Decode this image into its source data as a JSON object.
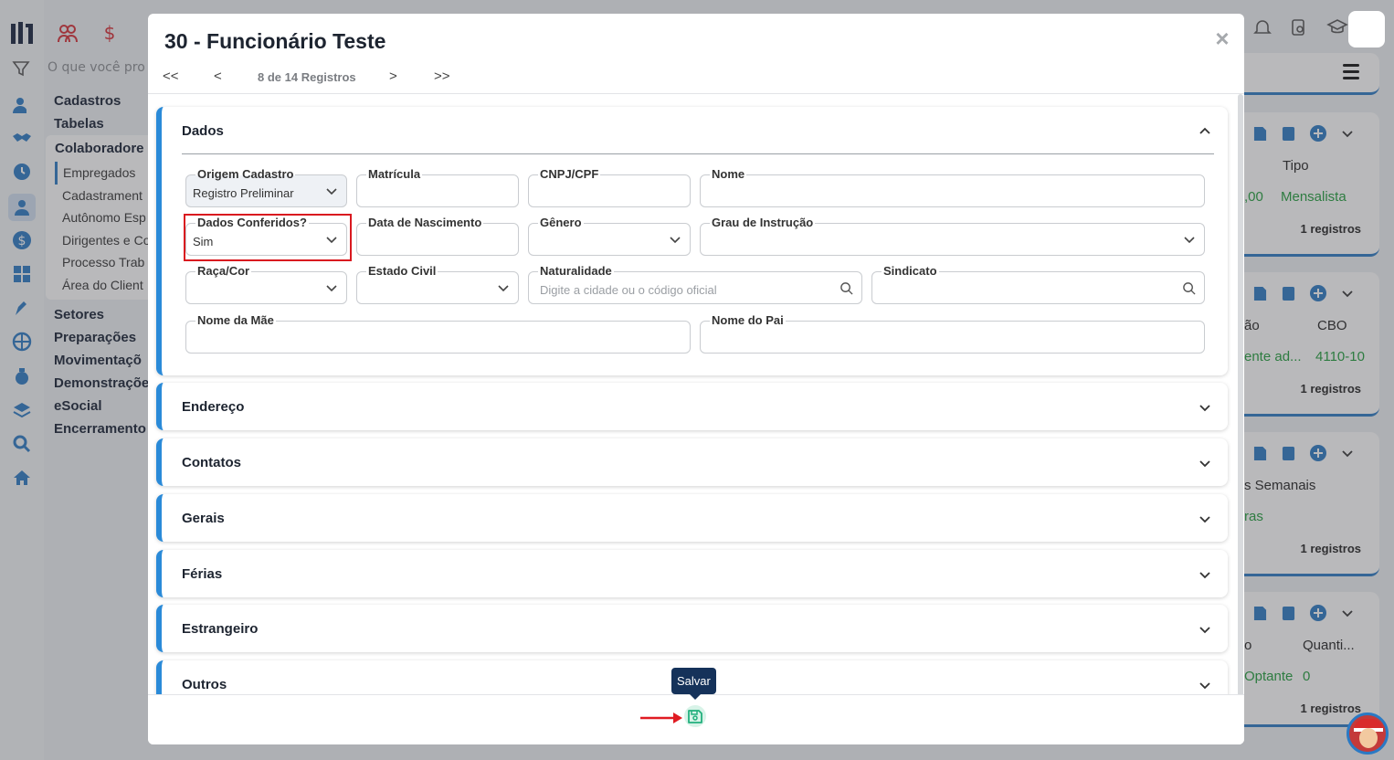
{
  "background": {
    "search_placeholder": "O que você pro",
    "menu_top": [
      "Cadastros",
      "Tabelas"
    ],
    "submenu": {
      "title": "Colaboradore",
      "items": [
        "Empregados",
        "Cadastrament",
        "Autônomo Esp",
        "Dirigentes e Co",
        "Processo Trab",
        "Área do Client"
      ]
    },
    "menu_bottom": [
      "Setores",
      "Preparações",
      "Movimentaçõ",
      "Demonstraçõe",
      "eSocial",
      "Encerramento"
    ],
    "cards": [
      {
        "col1": "",
        "col2": "Tipo",
        "val1": ",00",
        "val2": "Mensalista",
        "count": "1 registros"
      },
      {
        "col1": "ão",
        "col2": "CBO",
        "val1": "ente ad...",
        "val2": "4110-10",
        "count": "1 registros"
      },
      {
        "col1": "s Semanais",
        "col2": "",
        "val1": "ras",
        "val2": "",
        "count": "1 registros"
      },
      {
        "col1": "o",
        "col2": "Quanti...",
        "val1": "Optante",
        "val2": "0",
        "count": "1 registros"
      }
    ]
  },
  "modal": {
    "title": "30 - Funcionário Teste",
    "close_label": "×",
    "pager": {
      "first": "<<",
      "prev": "<",
      "records": "8 de 14 Registros",
      "next": ">",
      "last": ">>"
    },
    "sections": {
      "dados": "Dados",
      "endereco": "Endereço",
      "contatos": "Contatos",
      "gerais": "Gerais",
      "ferias": "Férias",
      "estrangeiro": "Estrangeiro",
      "outros": "Outros"
    },
    "fields": {
      "origem_cadastro": {
        "label": "Origem Cadastro",
        "value": "Registro Preliminar"
      },
      "matricula": {
        "label": "Matrícula",
        "value": ""
      },
      "cnpj_cpf": {
        "label": "CNPJ/CPF",
        "value": ""
      },
      "nome": {
        "label": "Nome",
        "value": ""
      },
      "dados_conferidos": {
        "label": "Dados Conferidos?",
        "value": "Sim"
      },
      "data_nascimento": {
        "label": "Data de Nascimento",
        "value": ""
      },
      "genero": {
        "label": "Gênero",
        "value": ""
      },
      "grau_instrucao": {
        "label": "Grau de Instrução",
        "value": ""
      },
      "raca_cor": {
        "label": "Raça/Cor",
        "value": ""
      },
      "estado_civil": {
        "label": "Estado Civil",
        "value": ""
      },
      "naturalidade": {
        "label": "Naturalidade",
        "placeholder": "Digite a cidade ou o código oficial"
      },
      "sindicato": {
        "label": "Sindicato",
        "placeholder": ""
      },
      "nome_mae": {
        "label": "Nome da Mãe",
        "value": ""
      },
      "nome_pai": {
        "label": "Nome do Pai",
        "value": ""
      }
    },
    "footer": {
      "tooltip": "Salvar"
    }
  },
  "colors": {
    "accent": "#2a8ad8",
    "save": "#22b07d",
    "highlight": "#d9191f",
    "tooltip": "#15325a"
  }
}
